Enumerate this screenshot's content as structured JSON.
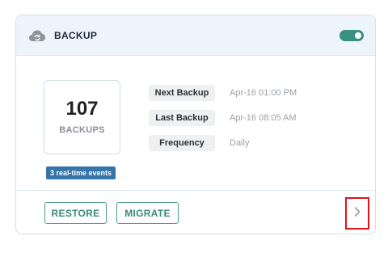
{
  "header": {
    "icon": "cloud-sync-icon",
    "title": "BACKUP",
    "toggle_on": true,
    "toggle_color": "#3a9080"
  },
  "summary": {
    "count": "107",
    "count_label": "BACKUPS",
    "events_badge": "3 real-time events",
    "badge_color": "#3675a9"
  },
  "details": [
    {
      "label": "Next Backup",
      "value": "Apr-16 01:00 PM"
    },
    {
      "label": "Last Backup",
      "value": "Apr-16 08:05 AM"
    },
    {
      "label": "Frequency",
      "value": "Daily"
    }
  ],
  "footer": {
    "restore_label": "RESTORE",
    "migrate_label": "MIGRATE",
    "details_icon": "chevron-right-icon",
    "accent_color": "#3a8a78",
    "highlight_color": "#e3101c"
  }
}
